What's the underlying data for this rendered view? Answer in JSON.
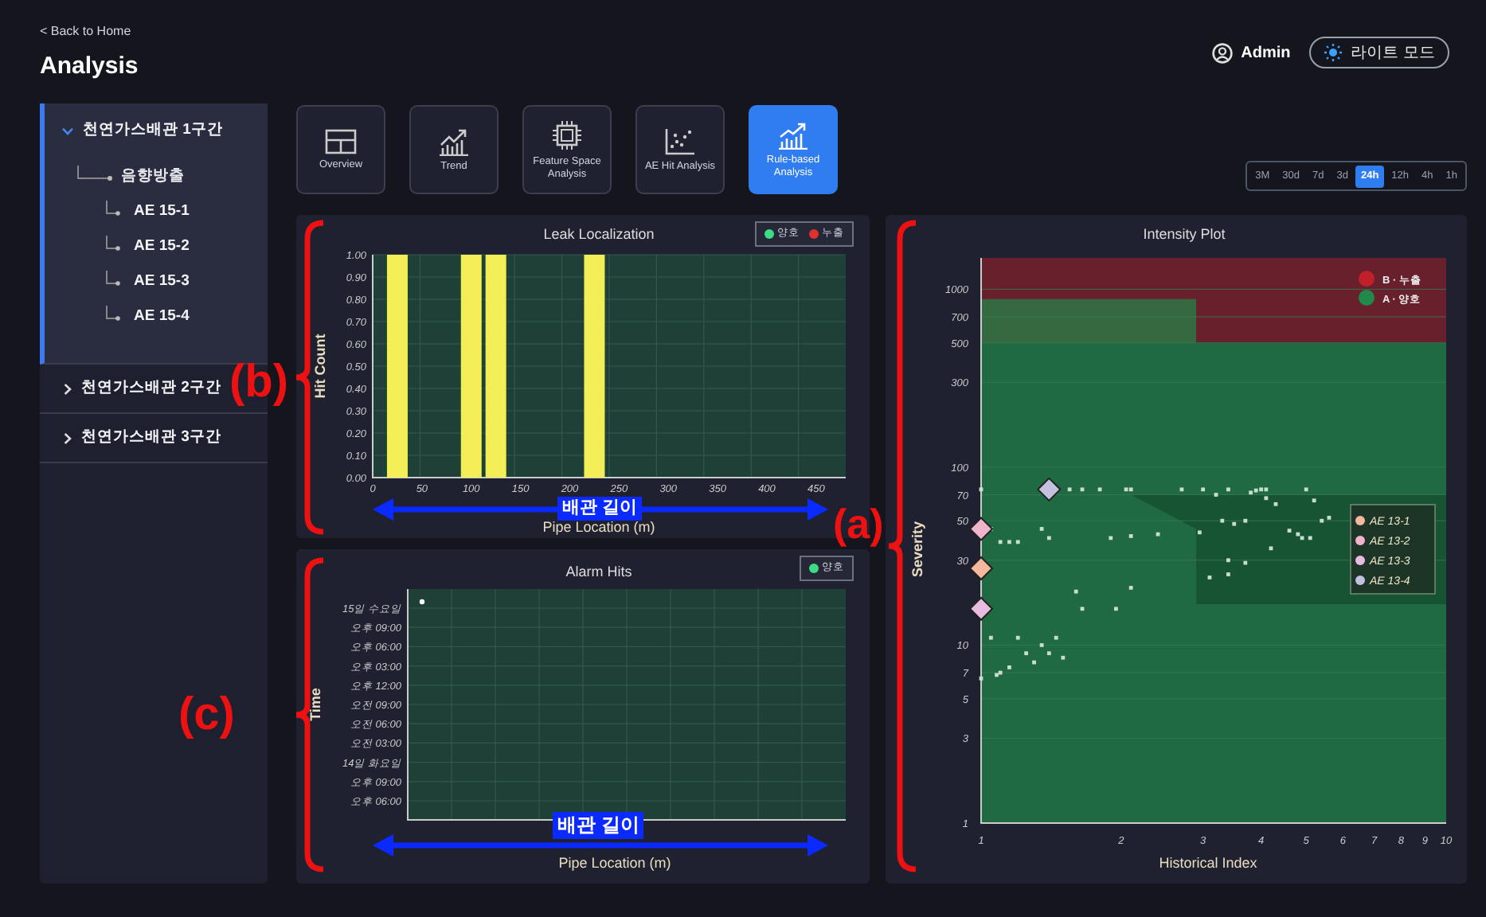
{
  "header": {
    "back_link": "< Back to Home",
    "title": "Analysis",
    "user": "Admin",
    "mode_button": "라이트 모드"
  },
  "sidebar": {
    "items": [
      {
        "label": "천연가스배관 1구간",
        "expanded": true,
        "selected": true,
        "children": [
          {
            "label": "음향방출",
            "children": [
              {
                "label": "AE 15-1"
              },
              {
                "label": "AE 15-2"
              },
              {
                "label": "AE 15-3"
              },
              {
                "label": "AE 15-4"
              }
            ]
          }
        ]
      },
      {
        "label": "천연가스배관 2구간",
        "expanded": false,
        "selected": false
      },
      {
        "label": "천연가스배관 3구간",
        "expanded": false,
        "selected": false
      }
    ]
  },
  "tabs": [
    {
      "label": "Overview",
      "selected": false
    },
    {
      "label": "Trend",
      "selected": false
    },
    {
      "label": "Feature Space Analysis",
      "selected": false
    },
    {
      "label": "AE Hit Analysis",
      "selected": false
    },
    {
      "label": "Rule-based Analysis",
      "selected": true
    }
  ],
  "time_ranges": [
    {
      "label": "3M",
      "selected": false
    },
    {
      "label": "30d",
      "selected": false
    },
    {
      "label": "7d",
      "selected": false
    },
    {
      "label": "3d",
      "selected": false
    },
    {
      "label": "24h",
      "selected": true
    },
    {
      "label": "12h",
      "selected": false
    },
    {
      "label": "4h",
      "selected": false
    },
    {
      "label": "1h",
      "selected": false
    }
  ],
  "leak_localization": {
    "legend": [
      {
        "label": "양호",
        "color": "#3ddc84"
      },
      {
        "label": "누출",
        "color": "#e03030"
      }
    ],
    "chart_data": {
      "type": "bar",
      "title": "Leak Localization",
      "xlabel": "Pipe Location (m)",
      "ylabel": "Hit Count",
      "x": [
        25,
        100,
        125,
        225
      ],
      "values": [
        1,
        1,
        1,
        1
      ],
      "xlim": [
        0,
        480
      ],
      "ylim": [
        0,
        1
      ],
      "xticks": [
        0,
        50,
        100,
        150,
        200,
        250,
        300,
        350,
        400,
        450
      ],
      "grid": true,
      "yticks": [
        {
          "value": 0,
          "label": "0.00"
        },
        {
          "value": 0.1,
          "label": "0.10"
        },
        {
          "value": 0.2,
          "label": "0.20"
        },
        {
          "value": 0.3,
          "label": "0.30"
        },
        {
          "value": 0.4,
          "label": "0.40"
        },
        {
          "value": 0.5,
          "label": "0.50"
        },
        {
          "value": 0.6,
          "label": "0.60"
        },
        {
          "value": 0.7,
          "label": "0.70"
        },
        {
          "value": 0.8,
          "label": "0.80"
        },
        {
          "value": 0.9,
          "label": "0.90"
        },
        {
          "value": 1,
          "label": "1.00"
        }
      ]
    }
  },
  "alarm_hits": {
    "title": "Alarm Hits",
    "xlabel": "Pipe Location (m)",
    "ylabel": "Time",
    "legend": [
      {
        "label": "양호",
        "color": "#3ddc84"
      }
    ],
    "y_axis_labels": [
      "15일 수요일",
      "오후 09:00",
      "오후 06:00",
      "오후 03:00",
      "오후 12:00",
      "오전 09:00",
      "오전 06:00",
      "오전 03:00",
      "14일 화요일",
      "오후 09:00",
      "오후 06:00"
    ]
  },
  "intensity_plot": {
    "zones": [
      {
        "label": "B · 누출",
        "color": "#c0202a"
      },
      {
        "label": "A · 양호",
        "color": "#1f8a4a"
      }
    ],
    "title": "Intensity Plot",
    "xlabel": "Historical Index",
    "ylabel": "Severity",
    "x_axis_labels": [
      "1",
      "2",
      "3",
      "4",
      "5",
      "6",
      "7",
      "8",
      "9",
      "10"
    ],
    "y_axis_labels": [
      "1000",
      "700",
      "500",
      "300",
      "100",
      "70",
      "50",
      "30",
      "10",
      "7",
      "5",
      "3",
      "1"
    ],
    "legend": [
      {
        "label": "AE 13-1",
        "color": "#f4b89c"
      },
      {
        "label": "AE 13-2",
        "color": "#f0b4cc"
      },
      {
        "label": "AE 13-3",
        "color": "#e8bce0"
      },
      {
        "label": "AE 13-4",
        "color": "#c4c0e0"
      }
    ]
  },
  "annotations": [
    {
      "label": "(a)"
    },
    {
      "label": "(b)"
    },
    {
      "label": "(c)"
    }
  ],
  "arrows": [
    {
      "label": "배관 길이"
    },
    {
      "label": "배관 길이"
    }
  ]
}
